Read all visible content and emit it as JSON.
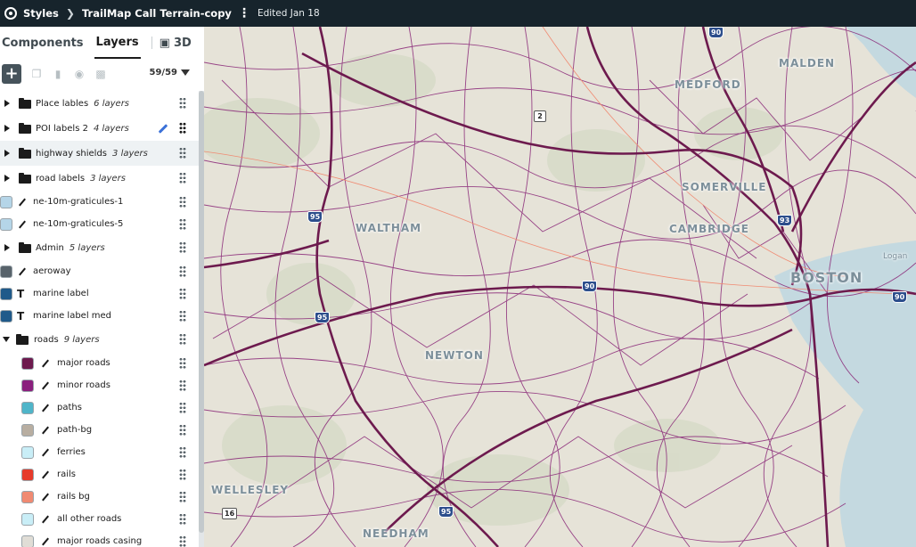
{
  "topbar": {
    "styles_label": "Styles",
    "style_name": "TrailMap Call Terrain-copy",
    "edited": "Edited Jan 18"
  },
  "tabs": {
    "components": "Components",
    "layers": "Layers",
    "three_d": "3D"
  },
  "toolbar": {
    "add": "+",
    "count": "59/59"
  },
  "layers": [
    {
      "name": "Place lables",
      "count": "6 layers",
      "kind": "group"
    },
    {
      "name": "POI labels 2",
      "count": "4 layers",
      "kind": "group"
    },
    {
      "name": "highway shields",
      "count": "3 layers",
      "kind": "group"
    },
    {
      "name": "road labels",
      "count": "3 layers",
      "kind": "group"
    },
    {
      "name": "ne-10m-graticules-1",
      "kind": "line",
      "color": "#b5d5e8"
    },
    {
      "name": "ne-10m-graticules-5",
      "kind": "line",
      "color": "#b5d5e8"
    },
    {
      "name": "Admin",
      "count": "5 layers",
      "kind": "group"
    },
    {
      "name": "aeroway",
      "kind": "line",
      "color": "#58636b"
    },
    {
      "name": "marine label",
      "kind": "symbol",
      "color": "#1f5a8a"
    },
    {
      "name": "marine label med",
      "kind": "symbol",
      "color": "#1f5a8a"
    },
    {
      "name": "roads",
      "count": "9 layers",
      "kind": "group-open"
    },
    {
      "name": "major roads",
      "kind": "line",
      "color": "#6d1a4e"
    },
    {
      "name": "minor roads",
      "kind": "line",
      "color": "#8a1f7d"
    },
    {
      "name": "paths",
      "kind": "line",
      "color": "#4fb5c9"
    },
    {
      "name": "path-bg",
      "kind": "line",
      "color": "#b8aea1"
    },
    {
      "name": "ferries",
      "kind": "line",
      "color": "#c9eef7"
    },
    {
      "name": "rails",
      "kind": "line",
      "color": "#e63a2a"
    },
    {
      "name": "rails bg",
      "kind": "line",
      "color": "#f08a72"
    },
    {
      "name": "all other roads",
      "kind": "line",
      "color": "#c9eef7"
    },
    {
      "name": "major roads casing",
      "kind": "line",
      "color": "#e0ddd6"
    }
  ],
  "map": {
    "places": [
      "MALDEN",
      "MEDFORD",
      "SOMERVILLE",
      "WALTHAM",
      "CAMBRIDGE",
      "BOSTON",
      "NEWTON",
      "WELLESLEY",
      "NEEDHAM",
      "Logan"
    ],
    "shields": [
      "2",
      "95",
      "93",
      "90",
      "90",
      "95",
      "90",
      "16",
      "95"
    ],
    "colors": {
      "road_major": "#6d1a4e",
      "road_minor": "#8a2878",
      "water": "#c4d9e0",
      "land": "#e6e3d8",
      "park": "#d3d8c4"
    }
  }
}
